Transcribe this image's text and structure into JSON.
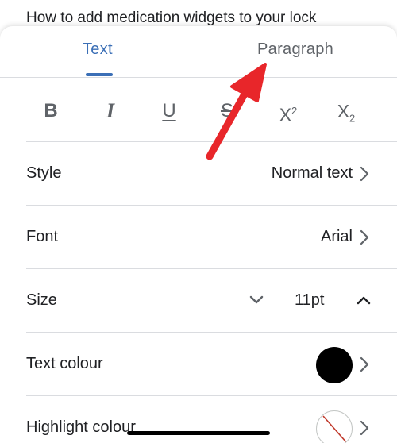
{
  "document": {
    "text": "How to add medication widgets to your lock"
  },
  "tabs": [
    {
      "label": "Text",
      "active": true
    },
    {
      "label": "Paragraph",
      "active": false
    }
  ],
  "format_buttons": {
    "bold": "B",
    "italic": "I",
    "underline": "U",
    "strikethrough": "S",
    "superscript_base": "X",
    "superscript_mark": "2",
    "subscript_base": "X",
    "subscript_mark": "2"
  },
  "rows": {
    "style": {
      "label": "Style",
      "value": "Normal text"
    },
    "font": {
      "label": "Font",
      "value": "Arial"
    },
    "size": {
      "label": "Size",
      "value": "11pt"
    },
    "text_colour": {
      "label": "Text colour",
      "color": "#000000"
    },
    "highlight_colour": {
      "label": "Highlight colour",
      "color": "none"
    }
  },
  "colors": {
    "accent": "#3b6fb6",
    "annotation_arrow": "#e8262a",
    "divider": "#dadce0"
  },
  "icons": [
    "chevron-right-icon",
    "chevron-down-icon",
    "chevron-up-icon",
    "no-color-icon",
    "red-arrow-annotation"
  ]
}
